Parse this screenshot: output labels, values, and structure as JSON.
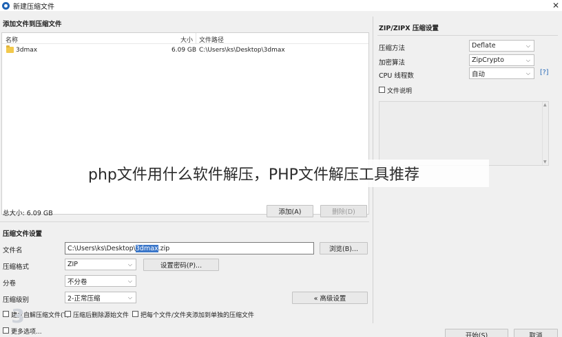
{
  "window": {
    "title": "新建压缩文件",
    "close_glyph": "✕"
  },
  "files": {
    "section_title": "添加文件到压缩文件",
    "columns": {
      "name": "名称",
      "size": "大小",
      "path": "文件路径"
    },
    "rows": [
      {
        "name": "3dmax",
        "size": "6.09 GB",
        "path": "C:\\Users\\ks\\Desktop\\3dmax"
      }
    ],
    "total": "总大小: 6.09 GB",
    "add_button": "添加(A)",
    "delete_button": "删除(D)"
  },
  "settings": {
    "section_title": "压缩文件设置",
    "filename_label": "文件名",
    "filename_prefix": "C:\\Users\\ks\\Desktop\\",
    "filename_selected": "3dmax",
    "filename_suffix": ".zip",
    "browse_button": "浏览(B)...",
    "format_label": "压缩格式",
    "format_value": "ZIP",
    "password_button": "设置密码(P)...",
    "split_label": "分卷",
    "split_value": "不分卷",
    "level_label": "压缩级别",
    "level_value": "2-正常压缩",
    "advanced_button": "« 高级设置",
    "opt1_label": "建立自解压缩文件(T)",
    "opt2_label": "压缩后删除源始文件",
    "opt3_label": "把每个文件/文件夹添加到单独的压缩文件",
    "more_options": "更多选项..."
  },
  "zip_settings": {
    "title": "ZIP/ZIPX 压缩设置",
    "method_label": "压缩方法",
    "method_value": "Deflate",
    "encryption_label": "加密算法",
    "encryption_value": "ZipCrypto",
    "cpu_label": "CPU 线程数",
    "cpu_value": "自动",
    "help_link": "[?]",
    "comment_label": "文件说明"
  },
  "footer": {
    "start_button": "开始(S)",
    "cancel_button": "取消"
  },
  "overlay": {
    "caption": "php文件用什么软件解压，PHP文件解压工具推荐"
  },
  "colors": {
    "selection": "#3a76c9",
    "folder": "#f2c94c",
    "link": "#1e63b5"
  },
  "icons": {
    "app": "archive-app-icon",
    "folder": "folder-icon",
    "dropdown": "chevron-down-icon"
  }
}
